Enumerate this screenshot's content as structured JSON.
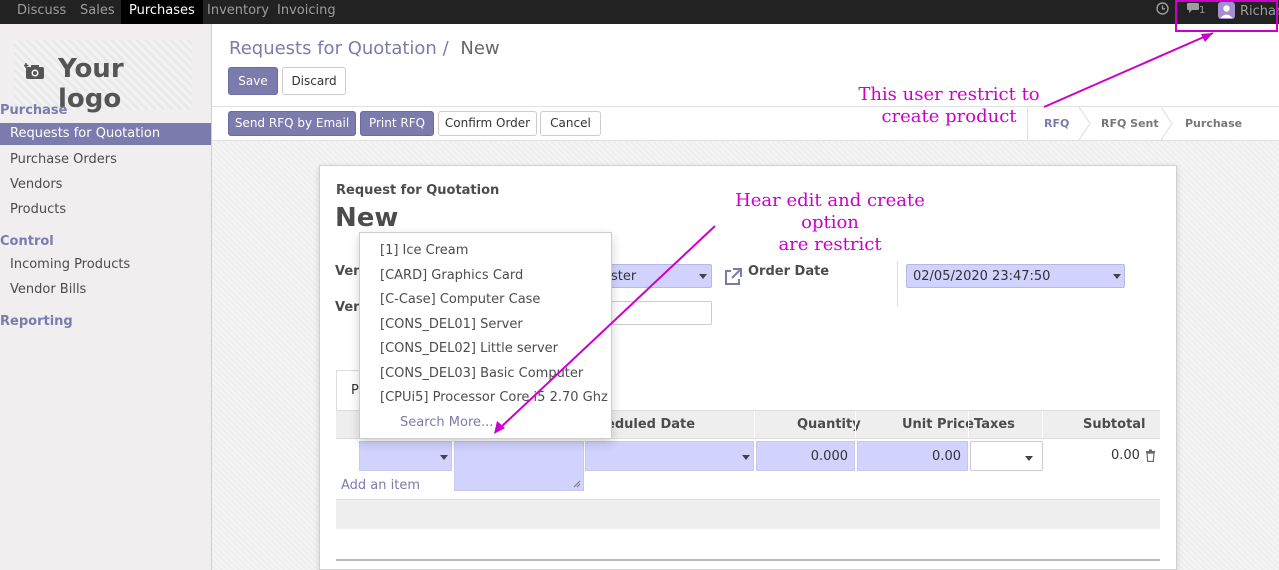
{
  "topbar": {
    "menu": [
      "Discuss",
      "Sales",
      "Purchases",
      "Inventory",
      "Invoicing"
    ],
    "active": "Purchases",
    "chat_count": "1",
    "user": "Richar"
  },
  "sidebar": {
    "logo_text": "Your logo",
    "sections": [
      {
        "title": "Purchase",
        "items": [
          "Requests for Quotation",
          "Purchase Orders",
          "Vendors",
          "Products"
        ]
      },
      {
        "title": "Control",
        "items": [
          "Incoming Products",
          "Vendor Bills"
        ]
      },
      {
        "title": "Reporting",
        "items": []
      }
    ],
    "active_item": "Requests for Quotation"
  },
  "header": {
    "breadcrumb_parent": "Requests for Quotation",
    "breadcrumb_sep": "/",
    "breadcrumb_current": "New",
    "save_label": "Save",
    "discard_label": "Discard"
  },
  "actions": {
    "send_rfq": "Send RFQ by Email",
    "print_rfq": "Print RFQ",
    "confirm": "Confirm Order",
    "cancel": "Cancel"
  },
  "status": {
    "stages": [
      "RFQ",
      "RFQ Sent",
      "Purchase Order"
    ],
    "active": "RFQ"
  },
  "form": {
    "subtitle": "Request for Quotation",
    "title": "New",
    "vendor_label_partial": "Ven",
    "vendor_ref_label_partial": "Ven",
    "vendor_value_partial": "ster",
    "order_date_label": "Order Date",
    "order_date_value": "02/05/2020 23:47:50",
    "tab_partial": "P"
  },
  "table": {
    "headers": {
      "scheduled_date": "eduled Date",
      "quantity": "Quantity",
      "unit_price": "Unit Price",
      "taxes": "Taxes",
      "subtotal": "Subtotal"
    },
    "row": {
      "quantity": "0.000",
      "unit_price": "0.00",
      "subtotal": "0.00"
    },
    "add_item": "Add an item"
  },
  "dropdown": {
    "items": [
      "[1] Ice Cream",
      "[CARD] Graphics Card",
      "[C-Case] Computer Case",
      "[CONS_DEL01] Server",
      "[CONS_DEL02] Little server",
      "[CONS_DEL03] Basic Computer",
      "[CPUi5] Processor Core i5 2.70 Ghz"
    ],
    "search_more": "Search More..."
  },
  "annotations": {
    "user_restrict_line1": "This user restrict to",
    "user_restrict_line2": "create product",
    "edit_restrict_line1": "Hear edit and create option",
    "edit_restrict_line2": "are restrict",
    "color": "#cc00cc"
  },
  "colors": {
    "brand": "#7c7bad",
    "required_field": "#d2d2ff"
  }
}
